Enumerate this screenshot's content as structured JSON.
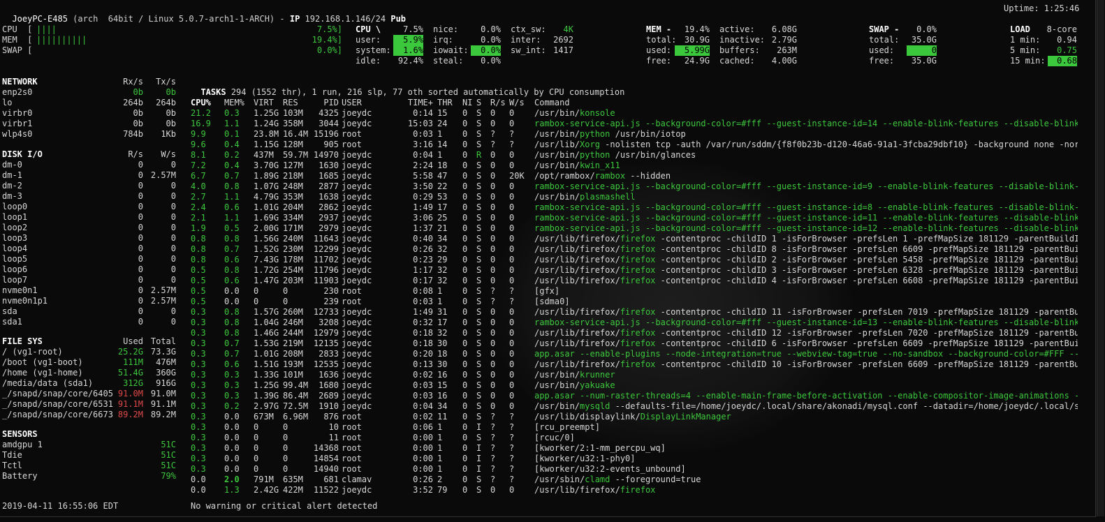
{
  "header": {
    "host": "JoeyPC-E485",
    "sysinfo": "(arch  64bit / Linux 5.0.7-arch1-1-ARCH) - ",
    "ip_label": "IP",
    "ip": "192.168.1.146/24",
    "pub": "Pub",
    "uptime": "Uptime: 1:25:46"
  },
  "quicklook": [
    {
      "label": "CPU  [",
      "bar": "||||",
      "pct": "7.5%]",
      "level": 0.075
    },
    {
      "label": "MEM  [",
      "bar": "||||||||||",
      "pct": "19.4%]",
      "level": 0.194
    },
    {
      "label": "SWAP [",
      "bar": "",
      "pct": "0.0%]",
      "level": 0.0
    }
  ],
  "cpu": {
    "title": "CPU \\",
    "total": "7.5%",
    "rows": [
      [
        "user:",
        "5.9%",
        "irq:",
        "0.0%",
        "inter:",
        "2692"
      ],
      [
        "system:",
        "1.6%",
        "iowait:",
        "0.0%",
        "sw_int:",
        "1417"
      ],
      [
        "idle:",
        "92.4%",
        "steal:",
        "0.0%",
        "",
        ""
      ]
    ],
    "nice_label": "nice:",
    "nice": "0.0%",
    "ctx_label": "ctx_sw:",
    "ctx": "4K"
  },
  "mem": {
    "title": "MEM -",
    "total_pct": "19.4%",
    "rows": [
      [
        "total:",
        "30.9G",
        "inactive:",
        "2.79G"
      ],
      [
        "used:",
        "5.99G",
        "buffers:",
        "263M"
      ],
      [
        "free:",
        "24.9G",
        "cached:",
        "4.00G"
      ]
    ],
    "active_label": "active:",
    "active": "6.08G"
  },
  "swap": {
    "title": "SWAP -",
    "pct": "0.0%",
    "rows": [
      [
        "total:",
        "35.0G"
      ],
      [
        "used:",
        "0"
      ],
      [
        "free:",
        "35.0G"
      ]
    ]
  },
  "load": {
    "title": "LOAD",
    "cores": "8-core",
    "rows": [
      [
        "1 min:",
        "0.94"
      ],
      [
        "5 min:",
        "0.75"
      ],
      [
        "15 min:",
        "0.68"
      ]
    ]
  },
  "network": {
    "title": "NETWORK",
    "rx": "Rx/s",
    "tx": "Tx/s",
    "rows": [
      [
        "enp2s0",
        "0b",
        "0b"
      ],
      [
        "lo",
        "264b",
        "264b"
      ],
      [
        "virbr0",
        "0b",
        "0b"
      ],
      [
        "virbr1",
        "0b",
        "0b"
      ],
      [
        "wlp4s0",
        "784b",
        "1Kb"
      ]
    ]
  },
  "diskio": {
    "title": "DISK I/O",
    "r": "R/s",
    "w": "W/s",
    "rows": [
      [
        "dm-0",
        "0",
        "0"
      ],
      [
        "dm-1",
        "0",
        "2.57M"
      ],
      [
        "dm-2",
        "0",
        "0"
      ],
      [
        "dm-3",
        "0",
        "0"
      ],
      [
        "loop0",
        "0",
        "0"
      ],
      [
        "loop1",
        "0",
        "0"
      ],
      [
        "loop2",
        "0",
        "0"
      ],
      [
        "loop3",
        "0",
        "0"
      ],
      [
        "loop4",
        "0",
        "0"
      ],
      [
        "loop5",
        "0",
        "0"
      ],
      [
        "loop6",
        "0",
        "0"
      ],
      [
        "loop7",
        "0",
        "0"
      ],
      [
        "nvme0n1",
        "0",
        "2.57M"
      ],
      [
        "nvme0n1p1",
        "0",
        "2.57M"
      ],
      [
        "sda",
        "0",
        "0"
      ],
      [
        "sda1",
        "0",
        "0"
      ]
    ]
  },
  "filesys": {
    "title": "FILE SYS",
    "used": "Used",
    "total": "Total",
    "rows": [
      [
        "/ (vg1-root)",
        "25.2G",
        "73.3G"
      ],
      [
        "/boot (vg1-boot)",
        "111M",
        "476M"
      ],
      [
        "/home (vg1-home)",
        "51.4G",
        "360G"
      ],
      [
        "/media/data (sda1)",
        "312G",
        "916G"
      ],
      [
        "_/snapd/snap/core/6405",
        "91.0M",
        "91.0M"
      ],
      [
        "_/snapd/snap/core/6531",
        "91.1M",
        "91.1M"
      ],
      [
        "_/snapd/snap/core/6673",
        "89.2M",
        "89.2M"
      ]
    ]
  },
  "sensors": {
    "title": "SENSORS",
    "rows": [
      [
        "amdgpu 1",
        "51C"
      ],
      [
        "Tdie",
        "51C"
      ],
      [
        "Tctl",
        "51C"
      ],
      [
        "Battery",
        "79%"
      ]
    ]
  },
  "tasks": {
    "summary_label": "TASKS",
    "summary": "294 (1552 thr), 1 run, 216 slp, 77 oth sorted automatically by CPU consumption",
    "columns": [
      "CPU%",
      "MEM%",
      "VIRT",
      "RES",
      "PID",
      "USER",
      "TIME+",
      "THR",
      "NI",
      "S",
      "R/s",
      "W/s",
      "Command"
    ],
    "rows": [
      [
        "21.2",
        "0.3",
        "1.25G",
        "103M",
        "4325",
        "joeydc",
        "0:14",
        "15",
        "0",
        "S",
        "0",
        "0",
        "/usr/bin/",
        "konsole",
        ""
      ],
      [
        "16.9",
        "1.1",
        "1.24G",
        "358M",
        "3044",
        "joeydc",
        "15:03",
        "24",
        "0",
        "S",
        "0",
        "0",
        "",
        "rambox-service-api.js --background-color=#fff --guest-instance-id=14 --enable-blink-features --disable-blink-fea",
        ""
      ],
      [
        "9.9",
        "0.1",
        "23.8M",
        "16.4M",
        "15196",
        "root",
        "0:03",
        "1",
        "0",
        "S",
        "?",
        "?",
        "/usr/bin/",
        "python",
        " /usr/bin/iotop"
      ],
      [
        "9.6",
        "0.4",
        "1.15G",
        "128M",
        "905",
        "root",
        "3:16",
        "14",
        "0",
        "S",
        "?",
        "?",
        "/usr/lib/",
        "Xorg",
        " -nolisten tcp -auth /var/run/sddm/{f8f0b23b-d120-46a6-91a1-3fcba29dbf10} -background none -noreset"
      ],
      [
        "8.1",
        "0.2",
        "437M",
        "59.7M",
        "14970",
        "joeydc",
        "0:04",
        "1",
        "0",
        "R",
        "0",
        "0",
        "/usr/bin/",
        "python",
        " /usr/bin/glances"
      ],
      [
        "7.2",
        "0.4",
        "3.70G",
        "127M",
        "1630",
        "joeydc",
        "2:24",
        "18",
        "0",
        "S",
        "0",
        "0",
        "/usr/bin/",
        "kwin_x11",
        ""
      ],
      [
        "6.7",
        "0.7",
        "1.89G",
        "218M",
        "1685",
        "joeydc",
        "5:58",
        "47",
        "0",
        "S",
        "0",
        "20K",
        "/opt/rambox/",
        "rambox",
        " --hidden"
      ],
      [
        "4.0",
        "0.8",
        "1.07G",
        "248M",
        "2877",
        "joeydc",
        "3:50",
        "22",
        "0",
        "S",
        "0",
        "0",
        "",
        "rambox-service-api.js --background-color=#fff --guest-instance-id=9 --enable-blink-features --disable-blink-feat",
        ""
      ],
      [
        "2.7",
        "1.1",
        "4.79G",
        "353M",
        "1638",
        "joeydc",
        "0:29",
        "53",
        "0",
        "S",
        "0",
        "0",
        "/usr/bin/",
        "plasmashell",
        ""
      ],
      [
        "2.4",
        "0.6",
        "1.01G",
        "204M",
        "2862",
        "joeydc",
        "1:49",
        "17",
        "0",
        "S",
        "0",
        "0",
        "",
        "rambox-service-api.js --background-color=#fff --guest-instance-id=8 --enable-blink-features --disable-blink-feat",
        ""
      ],
      [
        "2.1",
        "1.1",
        "1.69G",
        "334M",
        "2937",
        "joeydc",
        "3:06",
        "25",
        "0",
        "S",
        "0",
        "0",
        "",
        "rambox-service-api.js --background-color=#fff --guest-instance-id=11 --enable-blink-features --disable-blink-fea",
        ""
      ],
      [
        "1.9",
        "0.5",
        "2.00G",
        "171M",
        "2979",
        "joeydc",
        "1:37",
        "21",
        "0",
        "S",
        "0",
        "0",
        "",
        "rambox-service-api.js --background-color=#fff --guest-instance-id=12 --enable-blink-features --disable-blink-fea",
        ""
      ],
      [
        "0.8",
        "0.8",
        "1.56G",
        "240M",
        "11643",
        "joeydc",
        "0:40",
        "34",
        "0",
        "S",
        "0",
        "0",
        "/usr/lib/firefox/",
        "firefox",
        " -contentproc -childID 1 -isForBrowser -prefsLen 1 -prefMapSize 181129 -parentBuildID 20"
      ],
      [
        "0.8",
        "0.7",
        "1.52G",
        "230M",
        "12299",
        "joeydc",
        "0:26",
        "32",
        "0",
        "S",
        "0",
        "0",
        "/usr/lib/firefox/",
        "firefox",
        " -contentproc -childID 8 -isForBrowser -prefsLen 6609 -prefMapSize 181129 -parentBuildID"
      ],
      [
        "0.8",
        "0.6",
        "7.43G",
        "178M",
        "11702",
        "joeydc",
        "0:23",
        "29",
        "0",
        "S",
        "0",
        "0",
        "/usr/lib/firefox/",
        "firefox",
        " -contentproc -childID 2 -isForBrowser -prefsLen 5458 -prefMapSize 181129 -parentBuildID"
      ],
      [
        "0.5",
        "0.8",
        "1.72G",
        "254M",
        "11796",
        "joeydc",
        "1:17",
        "32",
        "0",
        "S",
        "0",
        "0",
        "/usr/lib/firefox/",
        "firefox",
        " -contentproc -childID 3 -isForBrowser -prefsLen 6328 -prefMapSize 181129 -parentBuildID"
      ],
      [
        "0.5",
        "0.6",
        "1.47G",
        "203M",
        "11903",
        "joeydc",
        "0:17",
        "32",
        "0",
        "S",
        "0",
        "0",
        "/usr/lib/firefox/",
        "firefox",
        " -contentproc -childID 4 -isForBrowser -prefsLen 6608 -prefMapSize 181129 -parentBuildID"
      ],
      [
        "0.5",
        "0.0",
        "0",
        "0",
        "230",
        "root",
        "0:08",
        "1",
        "0",
        "S",
        "?",
        "?",
        "[gfx]",
        "",
        ""
      ],
      [
        "0.5",
        "0.0",
        "0",
        "0",
        "239",
        "root",
        "0:03",
        "1",
        "0",
        "S",
        "?",
        "?",
        "[sdma0]",
        "",
        ""
      ],
      [
        "0.3",
        "0.8",
        "1.57G",
        "260M",
        "12733",
        "joeydc",
        "1:49",
        "31",
        "0",
        "S",
        "0",
        "0",
        "/usr/lib/firefox/",
        "firefox",
        " -contentproc -childID 11 -isForBrowser -prefsLen 7019 -prefMapSize 181129 -parentBuildI"
      ],
      [
        "0.3",
        "0.8",
        "1.04G",
        "246M",
        "3208",
        "joeydc",
        "0:32",
        "17",
        "0",
        "S",
        "0",
        "0",
        "",
        "rambox-service-api.js --background-color=#fff --guest-instance-id=13 --enable-blink-features --disable-blink-fea",
        ""
      ],
      [
        "0.3",
        "0.8",
        "1.46G",
        "244M",
        "12979",
        "joeydc",
        "0:18",
        "32",
        "0",
        "S",
        "0",
        "0",
        "/usr/lib/firefox/",
        "firefox",
        " -contentproc -childID 12 -isForBrowser -prefsLen 7020 -prefMapSize 181129 -parentBuildI"
      ],
      [
        "0.3",
        "0.7",
        "1.53G",
        "219M",
        "12135",
        "joeydc",
        "0:18",
        "30",
        "0",
        "S",
        "0",
        "0",
        "/usr/lib/firefox/",
        "firefox",
        " -contentproc -childID 6 -isForBrowser -prefsLen 6609 -prefMapSize 181129 -parentBuildID"
      ],
      [
        "0.3",
        "0.7",
        "1.01G",
        "208M",
        "2833",
        "joeydc",
        "0:20",
        "18",
        "0",
        "S",
        "0",
        "0",
        "",
        "app.asar --enable-plugins --node-integration=true --webview-tag=true --no-sandbox --background-color=#FFF --num-",
        ""
      ],
      [
        "0.3",
        "0.6",
        "1.51G",
        "193M",
        "12535",
        "joeydc",
        "0:13",
        "30",
        "0",
        "S",
        "0",
        "0",
        "/usr/lib/firefox/",
        "firefox",
        " -contentproc -childID 10 -isForBrowser -prefsLen 6609 -prefMapSize 181129 -parentBuildI"
      ],
      [
        "0.3",
        "0.3",
        "1.33G",
        "101M",
        "1636",
        "joeydc",
        "0:02",
        "16",
        "0",
        "S",
        "0",
        "0",
        "/usr/bin/",
        "krunner",
        ""
      ],
      [
        "0.3",
        "0.3",
        "1.25G",
        "99.4M",
        "1680",
        "joeydc",
        "0:03",
        "15",
        "0",
        "S",
        "0",
        "0",
        "/usr/bin/",
        "yakuake",
        ""
      ],
      [
        "0.3",
        "0.3",
        "1.39G",
        "86.4M",
        "2689",
        "joeydc",
        "0:03",
        "16",
        "0",
        "S",
        "0",
        "0",
        "",
        "app.asar --num-raster-threads=4 --enable-main-frame-before-activation --enable-compositor-image-animations --ser",
        ""
      ],
      [
        "0.3",
        "0.2",
        "2.97G",
        "72.5M",
        "1910",
        "joeydc",
        "0:04",
        "34",
        "0",
        "S",
        "0",
        "0",
        "/usr/bin/",
        "mysqld",
        " --defaults-file=/home/joeydc/.local/share/akonadi/mysql.conf --datadir=/home/joeydc/.local/share"
      ],
      [
        "0.3",
        "0.0",
        "673M",
        "6.96M",
        "876",
        "root",
        "0:02",
        "11",
        "0",
        "S",
        "?",
        "?",
        "/usr/lib/displaylink/",
        "DisplayLinkManager",
        ""
      ],
      [
        "0.3",
        "0.0",
        "0",
        "0",
        "10",
        "root",
        "0:06",
        "1",
        "0",
        "I",
        "?",
        "?",
        "[rcu_preempt]",
        "",
        ""
      ],
      [
        "0.3",
        "0.0",
        "0",
        "0",
        "11",
        "root",
        "0:00",
        "1",
        "0",
        "S",
        "?",
        "?",
        "[rcuc/0]",
        "",
        ""
      ],
      [
        "0.3",
        "0.0",
        "0",
        "0",
        "14368",
        "root",
        "0:00",
        "1",
        "0",
        "I",
        "?",
        "?",
        "[kworker/2:1-mm_percpu_wq]",
        "",
        ""
      ],
      [
        "0.3",
        "0.0",
        "0",
        "0",
        "14854",
        "root",
        "0:00",
        "1",
        "0",
        "I",
        "?",
        "?",
        "[kworker/u32:1-phy0]",
        "",
        ""
      ],
      [
        "0.3",
        "0.0",
        "0",
        "0",
        "14940",
        "root",
        "0:00",
        "1",
        "0",
        "I",
        "?",
        "?",
        "[kworker/u32:2-events_unbound]",
        "",
        ""
      ],
      [
        "0.0",
        "2.0",
        "791M",
        "635M",
        "681",
        "clamav",
        "0:26",
        "2",
        "0",
        "S",
        "?",
        "?",
        "/usr/sbin/",
        "clamd",
        " --foreground=true"
      ],
      [
        "0.0",
        "1.3",
        "2.42G",
        "422M",
        "11522",
        "joeydc",
        "3:52",
        "79",
        "0",
        "S",
        "0",
        "0",
        "/usr/lib/firefox/",
        "firefox",
        ""
      ]
    ]
  },
  "footer": {
    "datetime": "2019-04-11 16:55:06 EDT",
    "alert": "No warning or critical alert detected"
  },
  "colors": {
    "ok": "#3cc83c",
    "critical": "#e04848",
    "background": "#0a0a0a"
  }
}
